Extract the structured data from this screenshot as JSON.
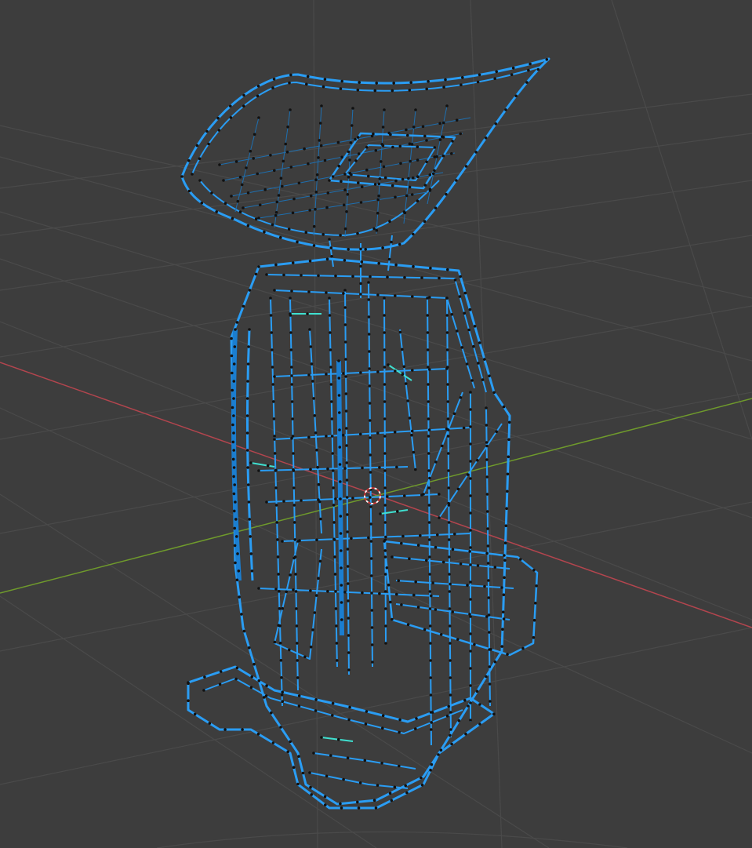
{
  "viewport": {
    "mode": "wireframe",
    "background": "#3d3d3d",
    "grid_color": "#4a4a4a",
    "x_axis_color": "#b3454e",
    "y_axis_color": "#6f9a2c",
    "wire_color": "#2a9df4",
    "wire_highlight": "#5cc8ff",
    "vertex_color": "#111111",
    "active_edge_color": "#3fe0d0",
    "cursor_icon": "3d-cursor-icon"
  }
}
